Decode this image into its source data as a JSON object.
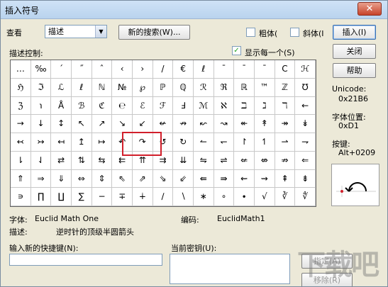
{
  "window": {
    "title": "插入符号",
    "close_glyph": "✕"
  },
  "toolbar": {
    "view_label": "查看",
    "view_select": "描述",
    "new_search_button": "新的搜索(W)...",
    "bold_label": "粗体(",
    "italic_label": "斜体(I",
    "insert_button": "插入(I)"
  },
  "description_control_label": "描述控制:",
  "show_each_label": "显示每一个(S)",
  "side": {
    "close_button": "关闭",
    "help_button": "帮助",
    "unicode_label": "Unicode:",
    "unicode_value": "0x21B6",
    "font_position_label": "字体位置:",
    "font_position_value": "0xD1",
    "key_label": "按键:",
    "key_value": "Alt+0209"
  },
  "grid": {
    "rows": [
      [
        "…",
        "‰",
        "´",
        "˝",
        "ˆ",
        "‹",
        "›",
        "/",
        "€",
        "ℓ",
        "¯",
        "¯",
        "¯",
        "C",
        "ℋ"
      ],
      [
        "ℌ",
        "ℑ",
        "ℒ",
        "ℓ",
        "ℕ",
        "№",
        "℘",
        "ℙ",
        "ℚ",
        "ℛ",
        "ℜ",
        "ℝ",
        "™",
        "ℤ",
        "℧"
      ],
      [
        "ℨ",
        "℩",
        "Å",
        "ℬ",
        "ℭ",
        "℮",
        "ℰ",
        "ℱ",
        "Ⅎ",
        "ℳ",
        "ℵ",
        "ℶ",
        "ℷ",
        "ℸ",
        "←"
      ],
      [
        "→",
        "↓",
        "↕",
        "↖",
        "↗",
        "↘",
        "↙",
        "↚",
        "↛",
        "↜",
        "↝",
        "↞",
        "↟",
        "↠",
        "↡"
      ],
      [
        "↢",
        "↣",
        "↤",
        "↥",
        "↦",
        "↶",
        "↷",
        "↺",
        "↻",
        "↼",
        "↽",
        "↾",
        "↿",
        "⇀",
        "⇁"
      ],
      [
        "⇂",
        "⇃",
        "⇄",
        "⇅",
        "⇆",
        "⇇",
        "⇈",
        "⇉",
        "⇊",
        "⇋",
        "⇌",
        "⇍",
        "⇎",
        "⇏",
        "⇐"
      ],
      [
        "⇑",
        "⇒",
        "⇓",
        "⇔",
        "⇕",
        "⇖",
        "⇗",
        "⇘",
        "⇙",
        "⇚",
        "⇛",
        "⇜",
        "⇝",
        "⇞",
        "⇟"
      ],
      [
        "∍",
        "∏",
        "∐",
        "∑",
        "−",
        "∓",
        "∔",
        "∕",
        "∖",
        "∗",
        "∘",
        "∙",
        "√",
        "∛",
        "∜"
      ]
    ]
  },
  "info": {
    "font_label": "字体:",
    "font_value": "Euclid Math One",
    "code_label": "编码:",
    "code_value": "EuclidMath1",
    "desc_label": "描述:",
    "desc_value": "逆时针的顶级半圆箭头"
  },
  "bottom": {
    "new_shortcut_label": "输入新的快捷键(N):",
    "current_key_label": "当前密钥(U):",
    "assign_button": "指定(A)",
    "remove_button": "移除(R)"
  },
  "watermark_text": "下载吧"
}
